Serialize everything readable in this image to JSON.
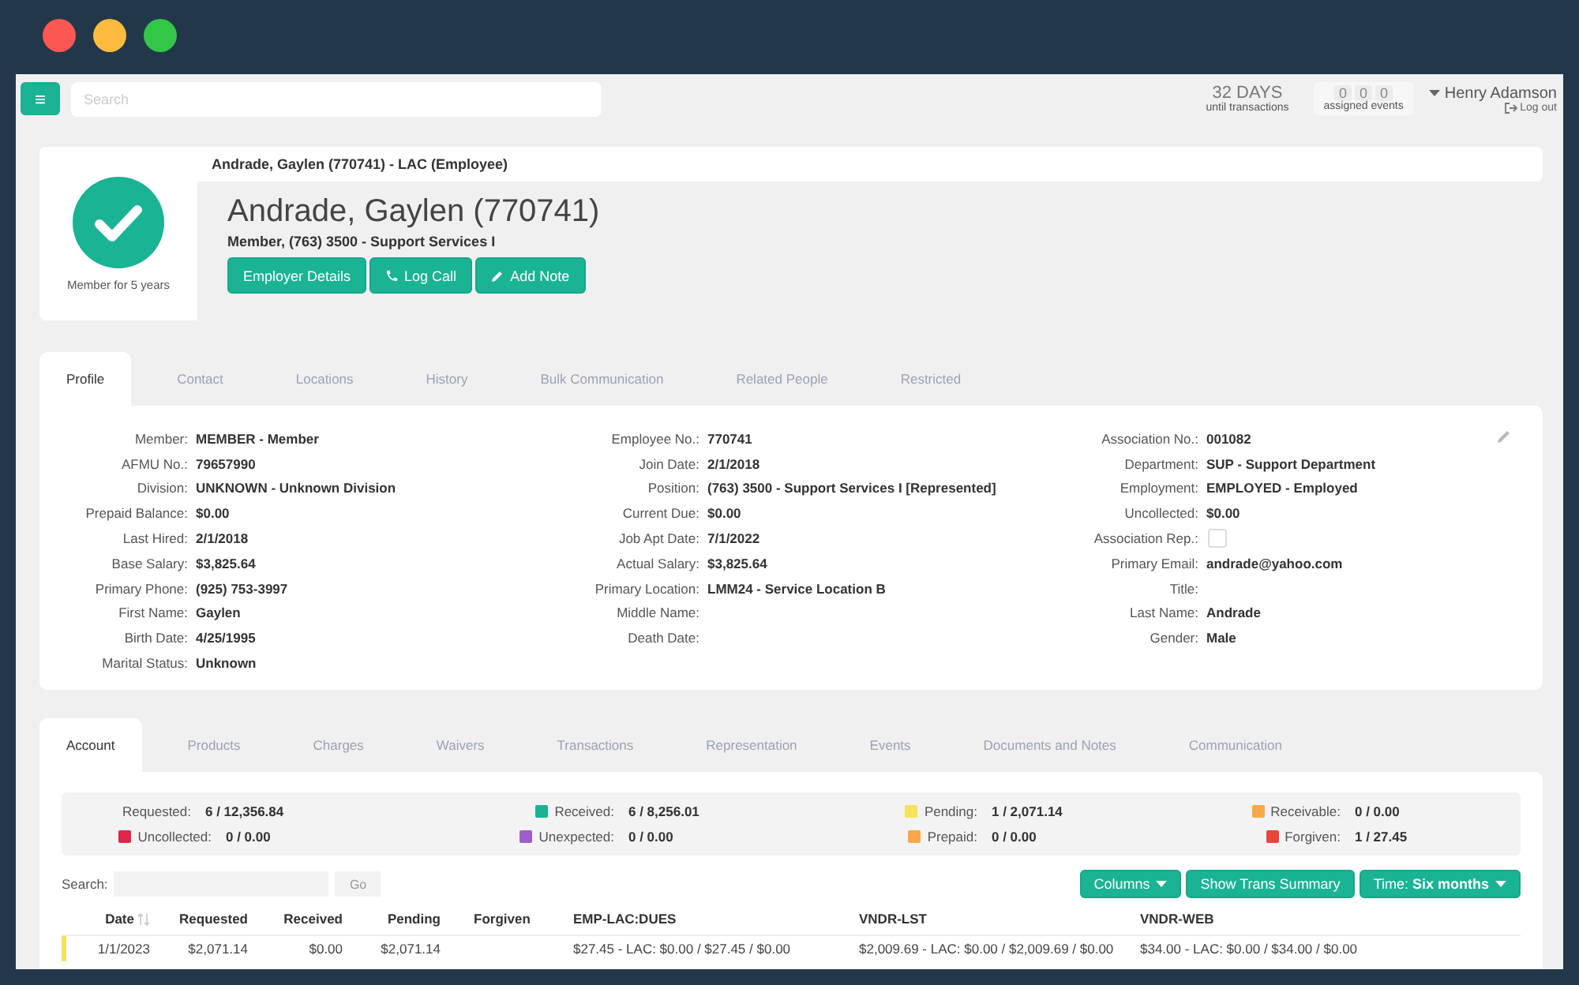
{
  "topbar": {
    "menu_button": "≡",
    "search_placeholder": "Search",
    "countdown": {
      "value": "32 DAYS",
      "caption": "until transactions"
    },
    "events": {
      "counts": [
        "0",
        "0",
        "0"
      ],
      "caption": "assigned events"
    },
    "user": {
      "name": "Henry Adamson",
      "logout": "Log out"
    }
  },
  "header": {
    "breadcrumb": "Andrade, Gaylen (770741) - LAC (Employee)",
    "badge_caption": "Member for 5 years",
    "name": "Andrade, Gaylen (770741)",
    "subtitle": "Member, (763) 3500 - Support Services I",
    "buttons": [
      {
        "label": "Employer Details",
        "kind": "plain"
      },
      {
        "label": "Log Call",
        "kind": "phone"
      },
      {
        "label": "Add Note",
        "kind": "pencil"
      }
    ]
  },
  "profile_tabs": [
    {
      "label": "Profile",
      "selected": true
    },
    {
      "label": "Contact",
      "selected": false
    },
    {
      "label": "Locations",
      "selected": false
    },
    {
      "label": "History",
      "selected": false
    },
    {
      "label": "Bulk Communication",
      "selected": false
    },
    {
      "label": "Related People",
      "selected": false
    },
    {
      "label": "Restricted",
      "selected": false
    }
  ],
  "profile_columns": [
    [
      {
        "kind": "text",
        "label": "Member:",
        "value": "MEMBER - Member"
      },
      {
        "kind": "text",
        "label": "AFMU No.:",
        "value": "79657990"
      },
      {
        "kind": "text",
        "label": "Division:",
        "value": "UNKNOWN - Unknown Division"
      },
      {
        "kind": "text",
        "label": "Prepaid Balance:",
        "value": "$0.00"
      },
      {
        "kind": "text",
        "label": "Last Hired:",
        "value": "2/1/2018"
      },
      {
        "kind": "text",
        "label": "Base Salary:",
        "value": "$3,825.64"
      },
      {
        "kind": "text",
        "label": "Primary Phone:",
        "value": "(925) 753-3997"
      },
      {
        "kind": "text",
        "label": "First Name:",
        "value": "Gaylen"
      },
      {
        "kind": "text",
        "label": "Birth Date:",
        "value": "4/25/1995"
      },
      {
        "kind": "text",
        "label": "Marital Status:",
        "value": "Unknown"
      }
    ],
    [
      {
        "kind": "text",
        "label": "Employee No.:",
        "value": "770741"
      },
      {
        "kind": "text",
        "label": "Join Date:",
        "value": "2/1/2018"
      },
      {
        "kind": "text",
        "label": "Position:",
        "value": "(763) 3500 - Support Services I [Represented]"
      },
      {
        "kind": "text",
        "label": "Current Due:",
        "value": "$0.00"
      },
      {
        "kind": "text",
        "label": "Job Apt Date:",
        "value": "7/1/2022"
      },
      {
        "kind": "text",
        "label": "Actual Salary:",
        "value": "$3,825.64"
      },
      {
        "kind": "text",
        "label": "Primary Location:",
        "value": "LMM24 - Service Location B"
      },
      {
        "kind": "text",
        "label": "Middle Name:"
      },
      {
        "kind": "text",
        "label": "Death Date:"
      }
    ],
    [
      {
        "kind": "text",
        "label": "Association No.:",
        "value": "001082"
      },
      {
        "kind": "text",
        "label": "Department:",
        "value": "SUP - Support Department"
      },
      {
        "kind": "text",
        "label": "Employment:",
        "value": "EMPLOYED - Employed"
      },
      {
        "kind": "text",
        "label": "Uncollected:",
        "value": "$0.00"
      },
      {
        "kind": "checkbox",
        "label": "Association Rep.:",
        "checked": false
      },
      {
        "kind": "text",
        "label": "Primary Email:",
        "value": "andrade@yahoo.com"
      },
      {
        "kind": "text",
        "label": "Title:"
      },
      {
        "kind": "text",
        "label": "Last Name:",
        "value": "Andrade"
      },
      {
        "kind": "text",
        "label": "Gender:",
        "value": "Male"
      }
    ]
  ],
  "account_tabs": [
    {
      "label": "Account",
      "selected": true
    },
    {
      "label": "Products",
      "selected": false
    },
    {
      "label": "Charges",
      "selected": false
    },
    {
      "label": "Waivers",
      "selected": false
    },
    {
      "label": "Transactions",
      "selected": false
    },
    {
      "label": "Representation",
      "selected": false
    },
    {
      "label": "Events",
      "selected": false
    },
    {
      "label": "Documents and Notes",
      "selected": false
    },
    {
      "label": "Communication",
      "selected": false
    }
  ],
  "summary": [
    {
      "label": "Requested:",
      "value": "6 / 12,356.84"
    },
    {
      "label": "Received:",
      "value": "6 / 8,256.01",
      "color": "#1ab394"
    },
    {
      "label": "Pending:",
      "value": "1 / 2,071.14",
      "color": "#f8e15b"
    },
    {
      "label": "Receivable:",
      "value": "0 / 0.00",
      "color": "#f8a84a"
    },
    {
      "label": "Uncollected:",
      "value": "0 / 0.00",
      "color": "#e0264a"
    },
    {
      "label": "Unexpected:",
      "value": "0 / 0.00",
      "color": "#9b5fc9"
    },
    {
      "label": "Prepaid:",
      "value": "0 / 0.00",
      "color": "#f8a84a"
    },
    {
      "label": "Forgiven:",
      "value": "1 / 27.45",
      "color": "#e8453c"
    }
  ],
  "table": {
    "search_label": "Search:",
    "go_button": "Go",
    "buttons": [
      {
        "label": "Columns",
        "kind": "dropdown"
      },
      {
        "label": "Show Trans Summary",
        "kind": "plain"
      },
      {
        "label": "Time: **Six months**",
        "kind": "dropdown"
      }
    ],
    "columns": [
      "Date",
      "Requested",
      "Received",
      "Pending",
      "Forgiven",
      "EMP-LAC:DUES",
      "VNDR-LST",
      "VNDR-WEB"
    ],
    "rows": [
      {
        "color": "#f8e15b",
        "cells": [
          "1/1/2023",
          "$2,071.14",
          "$0.00",
          "$2,071.14",
          "",
          "$27.45 - LAC: $0.00 / $27.45 / $0.00",
          "$2,009.69 - LAC: $0.00 / $2,009.69 / $0.00",
          "$34.00 - LAC: $0.00 / $34.00 / $0.00"
        ]
      }
    ]
  }
}
